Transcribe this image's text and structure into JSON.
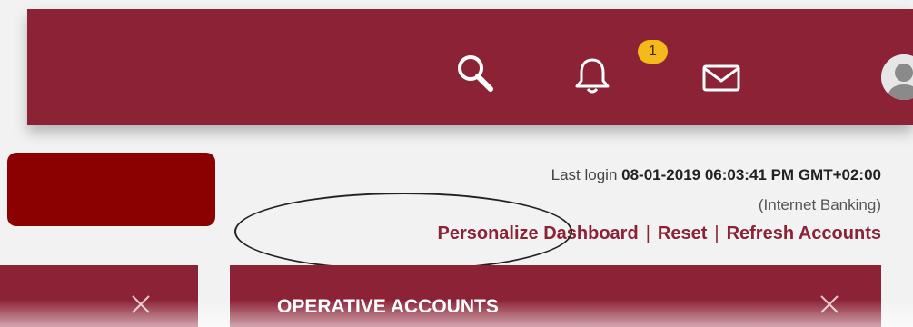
{
  "header": {
    "icons": [
      "search-icon",
      "bell-icon",
      "mail-icon",
      "avatar"
    ],
    "notification_count": "1",
    "brand_color": "#8c2236",
    "badge_color": "#f4b91a"
  },
  "session": {
    "last_login_label": "Last login",
    "last_login_value": "08-01-2019 06:03:41 PM GMT+02:00",
    "channel": "(Internet Banking)"
  },
  "dashboard_links": {
    "personalize": "Personalize Dashboard",
    "separator": "|",
    "reset": "Reset",
    "refresh": "Refresh Accounts"
  },
  "cards": {
    "operative_title": "OPERATIVE ACCOUNTS"
  },
  "redaction_color": "#8b0000"
}
